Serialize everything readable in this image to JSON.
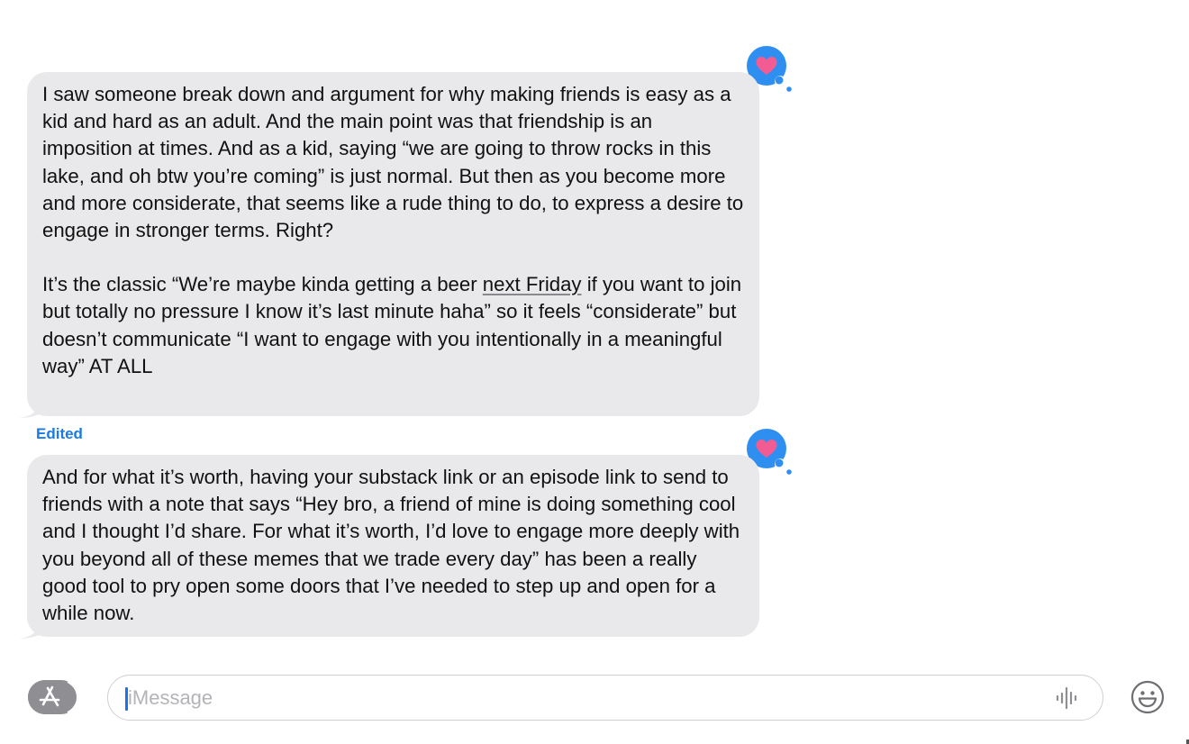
{
  "thread": {
    "messages": [
      {
        "paragraph_1": "I saw someone break down and argument for why making friends is easy as a kid and hard as an adult. And the main point was that friendship is an imposition at times. And as a kid, saying “we are going to throw rocks in this lake, and oh btw you’re coming” is just normal. But then as you become more and more considerate, that seems like a rude thing to do, to express a desire to engage in stronger terms. Right?",
        "paragraph_2_before_link": "It’s the classic “We’re maybe kinda getting a beer ",
        "date_link": "next Friday",
        "paragraph_2_after_link": " if you want to join but totally no pressure I know it’s last minute haha” so it feels “considerate” but doesn’t communicate “I want to engage with you intentionally in a meaningful way” AT ALL",
        "reaction_icon": "heart-icon"
      },
      {
        "edited_label": "Edited",
        "text": "And for what it’s worth, having your substack link or an episode link to send to friends with a note that says “Hey bro, a friend of mine is doing something cool and I thought I’d share. For what it’s worth, I’d love to engage more deeply with you beyond all of these memes that we trade every day” has been a really good tool to pry open some doors that I’ve needed to step up and open for a while now.",
        "reaction_icon": "heart-icon"
      }
    ]
  },
  "composer": {
    "placeholder": "iMessage",
    "value": "",
    "apps_icon": "app-store-icon",
    "audio_icon": "audio-waveform-icon",
    "emoji_icon": "emoji-icon"
  },
  "colors": {
    "bubble_background": "#e9e9eb",
    "tapback_blue": "#2f8ff0",
    "heart_pink": "#f35b93",
    "edited_blue": "#1a7ae6",
    "caret_blue": "#1a73e8"
  }
}
